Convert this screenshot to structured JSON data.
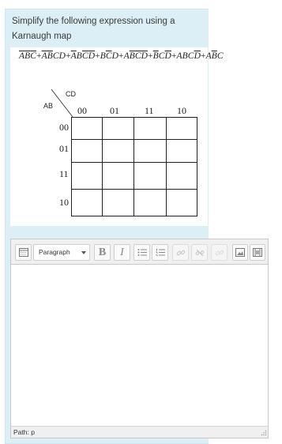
{
  "question": {
    "prompt": "Simplify the following expression using a Karnaugh map"
  },
  "expression": {
    "terms": [
      [
        {
          "t": "A",
          "ov": true
        },
        {
          "t": "B",
          "ov": true
        },
        {
          "t": "C",
          "ov": true
        }
      ],
      [
        {
          "t": "A",
          "ov": true
        },
        {
          "t": "B",
          "ov": true
        },
        {
          "t": "C",
          "ov": false
        },
        {
          "t": "D",
          "ov": false
        }
      ],
      [
        {
          "t": "A",
          "ov": true
        },
        {
          "t": "B",
          "ov": false
        },
        {
          "t": "C",
          "ov": true
        },
        {
          "t": "D",
          "ov": true
        }
      ],
      [
        {
          "t": "B",
          "ov": false
        },
        {
          "t": "C",
          "ov": true
        },
        {
          "t": "D",
          "ov": false
        }
      ],
      [
        {
          "t": "A",
          "ov": false
        },
        {
          "t": "B",
          "ov": true
        },
        {
          "t": "C",
          "ov": true
        },
        {
          "t": "D",
          "ov": true
        }
      ],
      [
        {
          "t": "B",
          "ov": true
        },
        {
          "t": "C",
          "ov": false
        },
        {
          "t": "D",
          "ov": true
        }
      ],
      [
        {
          "t": "A",
          "ov": false
        },
        {
          "t": "B",
          "ov": false
        },
        {
          "t": "C",
          "ov": false
        },
        {
          "t": "D",
          "ov": true
        }
      ],
      [
        {
          "t": "A",
          "ov": false
        },
        {
          "t": "B",
          "ov": true
        },
        {
          "t": "C",
          "ov": false
        }
      ]
    ],
    "plus": "+"
  },
  "kmap": {
    "cd_label": "CD",
    "ab_label": "AB",
    "columns": [
      "00",
      "01",
      "11",
      "10"
    ],
    "rows": [
      "00",
      "01",
      "11",
      "10"
    ]
  },
  "editor": {
    "format_select": "Paragraph",
    "bold": "B",
    "italic": "I",
    "status_path": "Path: p"
  },
  "colors": {
    "panel_bg": "#dceff7",
    "toolbar_bg": "#f0f0f0"
  },
  "icons": [
    "toolbar-toggle-icon",
    "bullet-list-icon",
    "numbered-list-icon",
    "link-icon",
    "unlink-icon",
    "anchor-icon",
    "image-icon",
    "media-icon",
    "resize-grip-icon"
  ]
}
